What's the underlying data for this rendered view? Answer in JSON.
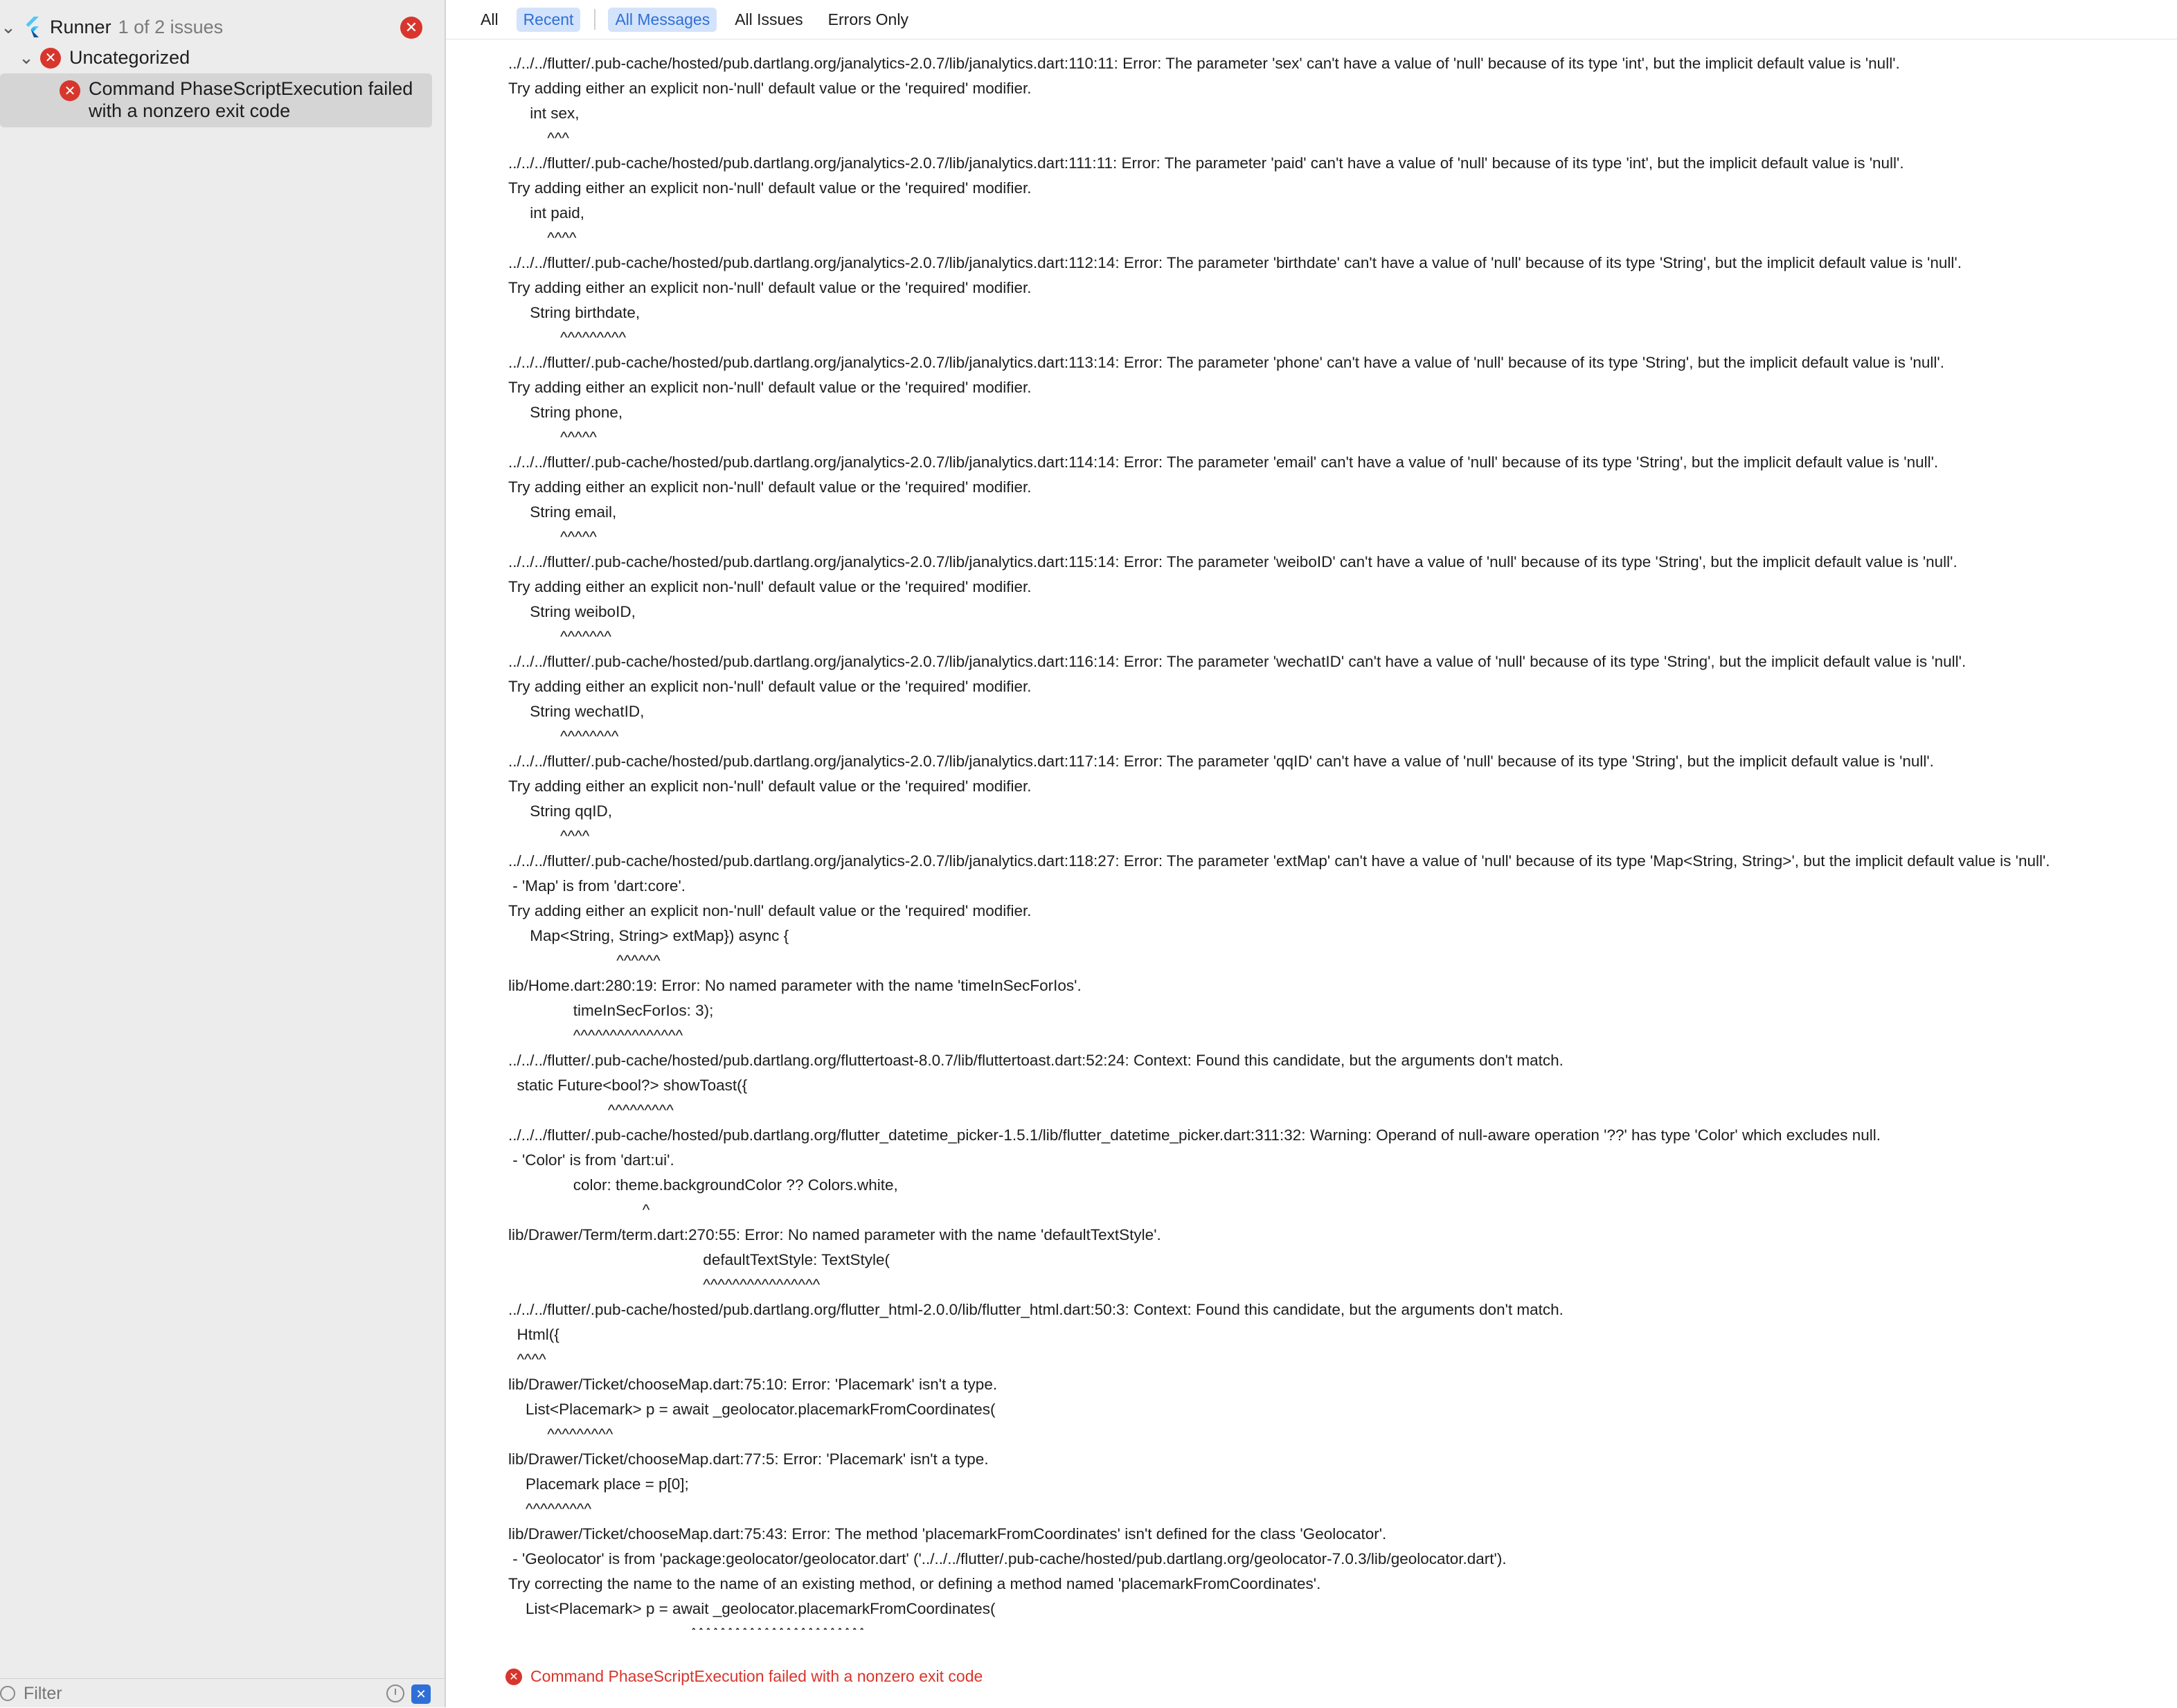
{
  "sidebar": {
    "runner_title": "Runner",
    "runner_count": "1 of 2 issues",
    "group_label": "Uncategorized",
    "issue_line1": "Command PhaseScriptExecution failed",
    "issue_line2": "with a nonzero exit code",
    "filter_placeholder": "Filter"
  },
  "toolbar": {
    "all": "All",
    "recent": "Recent",
    "all_messages": "All Messages",
    "all_issues": "All Issues",
    "errors_only": "Errors Only"
  },
  "log_lines": [
    "../../../flutter/.pub-cache/hosted/pub.dartlang.org/janalytics-2.0.7/lib/janalytics.dart:110:11: Error: The parameter 'sex' can't have a value of 'null' because of its type 'int', but the implicit default value is 'null'.",
    "Try adding either an explicit non-'null' default value or the 'required' modifier.",
    "     int sex,",
    "         ^^^",
    "../../../flutter/.pub-cache/hosted/pub.dartlang.org/janalytics-2.0.7/lib/janalytics.dart:111:11: Error: The parameter 'paid' can't have a value of 'null' because of its type 'int', but the implicit default value is 'null'.",
    "Try adding either an explicit non-'null' default value or the 'required' modifier.",
    "     int paid,",
    "         ^^^^",
    "../../../flutter/.pub-cache/hosted/pub.dartlang.org/janalytics-2.0.7/lib/janalytics.dart:112:14: Error: The parameter 'birthdate' can't have a value of 'null' because of its type 'String', but the implicit default value is 'null'.",
    "Try adding either an explicit non-'null' default value or the 'required' modifier.",
    "     String birthdate,",
    "            ^^^^^^^^^",
    "../../../flutter/.pub-cache/hosted/pub.dartlang.org/janalytics-2.0.7/lib/janalytics.dart:113:14: Error: The parameter 'phone' can't have a value of 'null' because of its type 'String', but the implicit default value is 'null'.",
    "Try adding either an explicit non-'null' default value or the 'required' modifier.",
    "     String phone,",
    "            ^^^^^",
    "../../../flutter/.pub-cache/hosted/pub.dartlang.org/janalytics-2.0.7/lib/janalytics.dart:114:14: Error: The parameter 'email' can't have a value of 'null' because of its type 'String', but the implicit default value is 'null'.",
    "Try adding either an explicit non-'null' default value or the 'required' modifier.",
    "     String email,",
    "            ^^^^^",
    "../../../flutter/.pub-cache/hosted/pub.dartlang.org/janalytics-2.0.7/lib/janalytics.dart:115:14: Error: The parameter 'weiboID' can't have a value of 'null' because of its type 'String', but the implicit default value is 'null'.",
    "Try adding either an explicit non-'null' default value or the 'required' modifier.",
    "     String weiboID,",
    "            ^^^^^^^",
    "../../../flutter/.pub-cache/hosted/pub.dartlang.org/janalytics-2.0.7/lib/janalytics.dart:116:14: Error: The parameter 'wechatID' can't have a value of 'null' because of its type 'String', but the implicit default value is 'null'.",
    "Try adding either an explicit non-'null' default value or the 'required' modifier.",
    "     String wechatID,",
    "            ^^^^^^^^",
    "../../../flutter/.pub-cache/hosted/pub.dartlang.org/janalytics-2.0.7/lib/janalytics.dart:117:14: Error: The parameter 'qqID' can't have a value of 'null' because of its type 'String', but the implicit default value is 'null'.",
    "Try adding either an explicit non-'null' default value or the 'required' modifier.",
    "     String qqID,",
    "            ^^^^",
    "../../../flutter/.pub-cache/hosted/pub.dartlang.org/janalytics-2.0.7/lib/janalytics.dart:118:27: Error: The parameter 'extMap' can't have a value of 'null' because of its type 'Map<String, String>', but the implicit default value is 'null'.",
    " - 'Map' is from 'dart:core'.",
    "Try adding either an explicit non-'null' default value or the 'required' modifier.",
    "     Map<String, String> extMap}) async {",
    "                         ^^^^^^",
    "lib/Home.dart:280:19: Error: No named parameter with the name 'timeInSecForIos'.",
    "               timeInSecForIos: 3);",
    "               ^^^^^^^^^^^^^^^",
    "../../../flutter/.pub-cache/hosted/pub.dartlang.org/fluttertoast-8.0.7/lib/fluttertoast.dart:52:24: Context: Found this candidate, but the arguments don't match.",
    "  static Future<bool?> showToast({",
    "                       ^^^^^^^^^",
    "../../../flutter/.pub-cache/hosted/pub.dartlang.org/flutter_datetime_picker-1.5.1/lib/flutter_datetime_picker.dart:311:32: Warning: Operand of null-aware operation '??' has type 'Color' which excludes null.",
    " - 'Color' is from 'dart:ui'.",
    "               color: theme.backgroundColor ?? Colors.white,",
    "                               ^",
    "lib/Drawer/Term/term.dart:270:55: Error: No named parameter with the name 'defaultTextStyle'.",
    "                                             defaultTextStyle: TextStyle(",
    "                                             ^^^^^^^^^^^^^^^^",
    "../../../flutter/.pub-cache/hosted/pub.dartlang.org/flutter_html-2.0.0/lib/flutter_html.dart:50:3: Context: Found this candidate, but the arguments don't match.",
    "  Html({",
    "  ^^^^",
    "lib/Drawer/Ticket/chooseMap.dart:75:10: Error: 'Placemark' isn't a type.",
    "    List<Placemark> p = await _geolocator.placemarkFromCoordinates(",
    "         ^^^^^^^^^",
    "lib/Drawer/Ticket/chooseMap.dart:77:5: Error: 'Placemark' isn't a type.",
    "    Placemark place = p[0];",
    "    ^^^^^^^^^",
    "lib/Drawer/Ticket/chooseMap.dart:75:43: Error: The method 'placemarkFromCoordinates' isn't defined for the class 'Geolocator'.",
    " - 'Geolocator' is from 'package:geolocator/geolocator.dart' ('../../../flutter/.pub-cache/hosted/pub.dartlang.org/geolocator-7.0.3/lib/geolocator.dart').",
    "Try correcting the name to the name of an existing method, or defining a method named 'placemarkFromCoordinates'.",
    "    List<Placemark> p = await _geolocator.placemarkFromCoordinates(",
    "                                          ^^^^^^^^^^^^^^^^^^^^^^^^"
  ],
  "footer": {
    "message": "Command PhaseScriptExecution failed with a nonzero exit code"
  },
  "colors": {
    "error": "#d8352c",
    "accent": "#2e6fd6",
    "selected_bg": "#d3e3fb"
  },
  "icons": {
    "flutter": "flutter-icon",
    "error": "error-icon",
    "disclosure": "chevron-down-icon",
    "filter": "filter-icon",
    "recent": "clock-icon",
    "issues_toggle": "error-filter-icon"
  }
}
